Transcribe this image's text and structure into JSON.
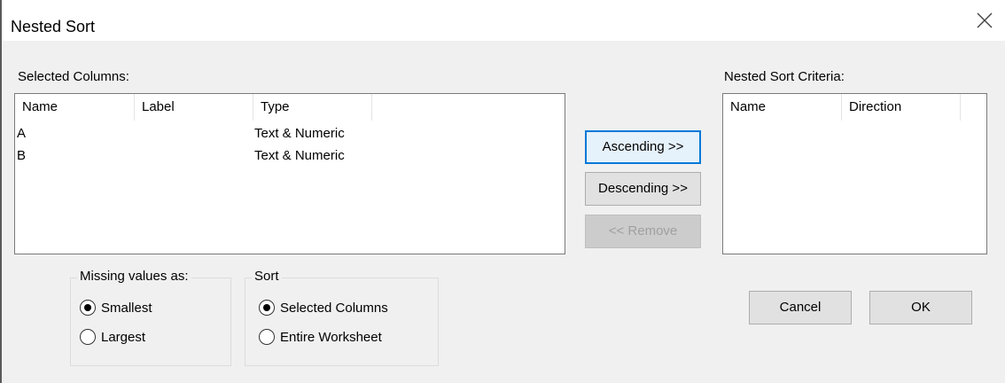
{
  "dialog": {
    "title": "Nested Sort"
  },
  "selected_columns": {
    "label": "Selected Columns:",
    "headers": [
      "Name",
      "Label",
      "Type"
    ],
    "rows": [
      {
        "name": "A",
        "label": "",
        "type": "Text & Numeric"
      },
      {
        "name": "B",
        "label": "",
        "type": "Text & Numeric"
      }
    ]
  },
  "actions": {
    "ascending": "Ascending >>",
    "descending": "Descending >>",
    "remove": "<< Remove"
  },
  "criteria": {
    "label": "Nested Sort Criteria:",
    "headers": [
      "Name",
      "Direction"
    ]
  },
  "missing_values": {
    "label": "Missing values as:",
    "options": [
      "Smallest",
      "Largest"
    ],
    "selected": "Smallest"
  },
  "sort": {
    "label": "Sort",
    "options": [
      "Selected Columns",
      "Entire Worksheet"
    ],
    "selected": "Selected Columns"
  },
  "footer": {
    "cancel": "Cancel",
    "ok": "OK"
  }
}
